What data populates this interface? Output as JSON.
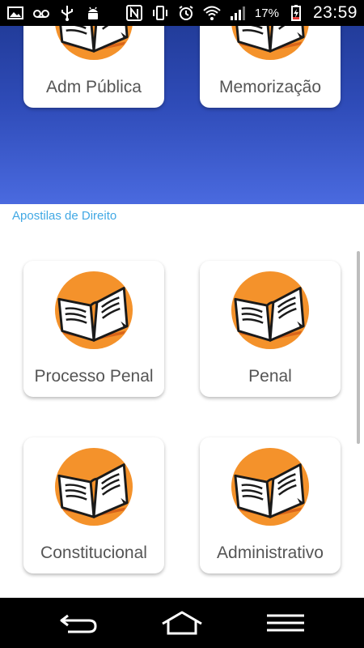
{
  "status_bar": {
    "battery_percent": "17%",
    "time": "23:59",
    "icons_left": [
      "image-icon",
      "voicemail-icon",
      "usb-icon",
      "android-debug-icon"
    ],
    "icons_right": [
      "nfc-icon",
      "vibrate-icon",
      "alarm-icon",
      "wifi-icon",
      "signal-icon",
      "battery-charging-icon"
    ]
  },
  "top_cards": [
    {
      "label": "Adm Pública"
    },
    {
      "label": "Memorização"
    }
  ],
  "section": {
    "title": "Apostilas de Direito",
    "cards": [
      {
        "label": "Processo Penal"
      },
      {
        "label": "Penal"
      },
      {
        "label": "Constitucional"
      },
      {
        "label": "Administrativo"
      }
    ]
  },
  "nav_bar": {
    "buttons": [
      "back-icon",
      "home-icon",
      "menu-icon"
    ]
  },
  "colors": {
    "header_gradient_top": "#223c9a",
    "header_gradient_bottom": "#4a6adf",
    "section_title": "#41a8e4",
    "book_circle": "#f4922b",
    "card_label": "#555555"
  }
}
